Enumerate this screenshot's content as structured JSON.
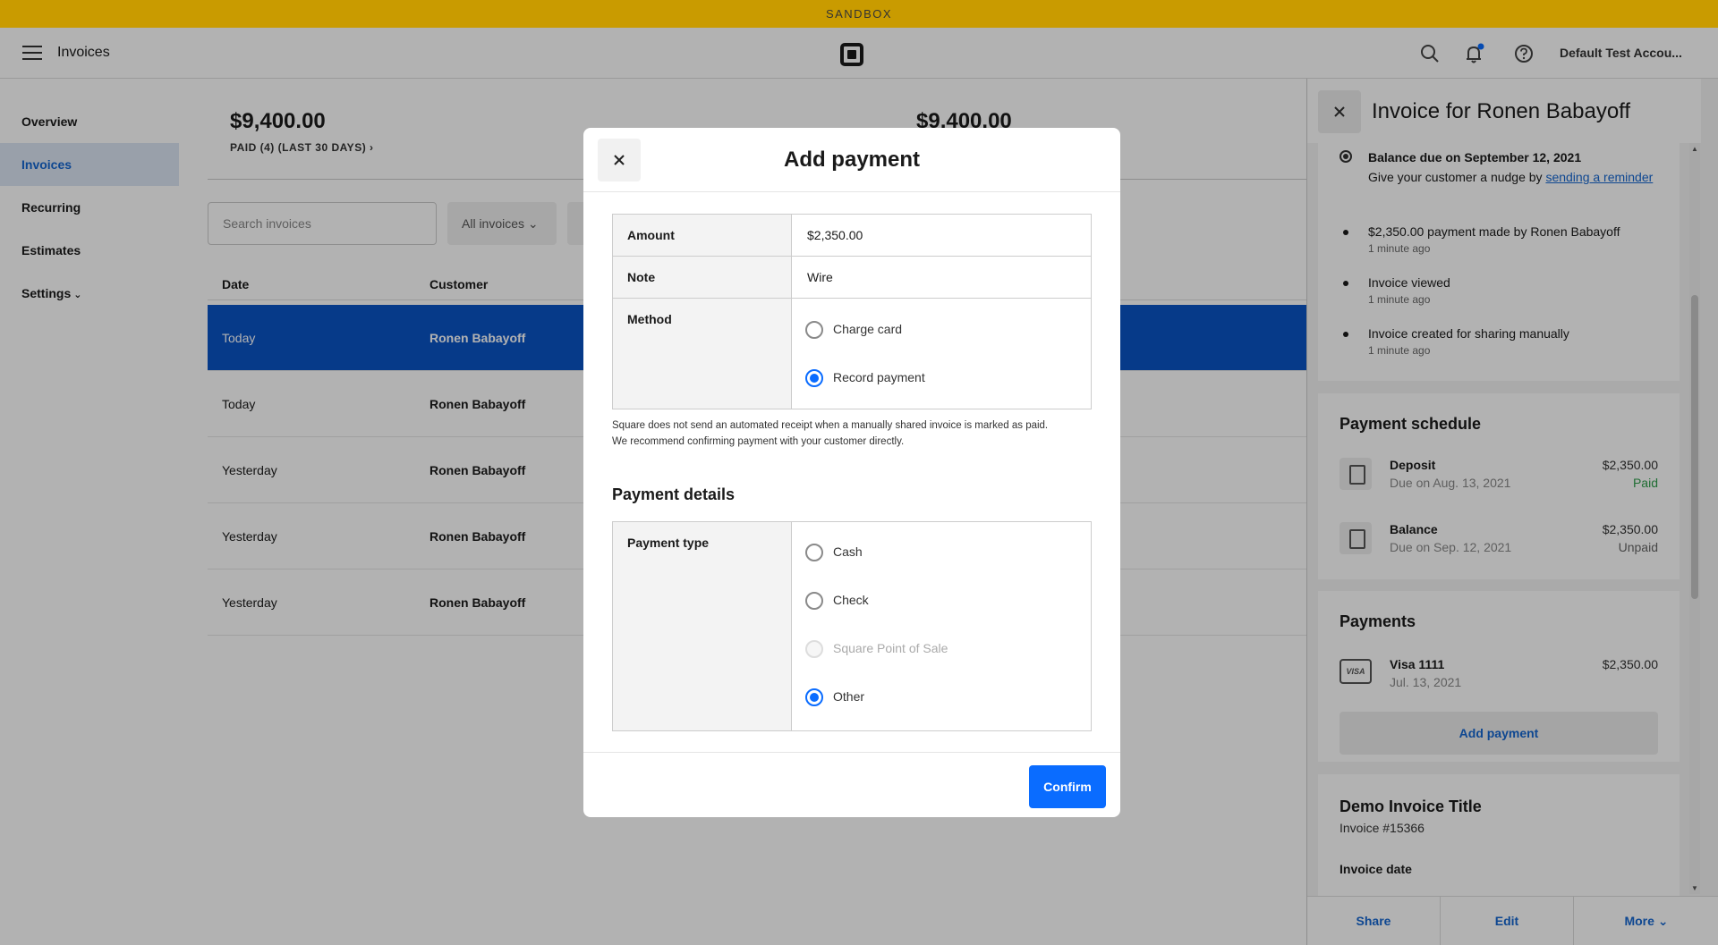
{
  "banner": {
    "text": "SANDBOX"
  },
  "topnav": {
    "title": "Invoices",
    "account": "Default Test Accou..."
  },
  "sidebar": {
    "items": [
      {
        "label": "Overview"
      },
      {
        "label": "Invoices"
      },
      {
        "label": "Recurring"
      },
      {
        "label": "Estimates"
      },
      {
        "label": "Settings"
      }
    ]
  },
  "main": {
    "stats": [
      {
        "value": "$9,400.00",
        "label": "PAID (4) (LAST 30 DAYS)"
      },
      {
        "value": "$9,400.00",
        "label": ""
      }
    ],
    "search_placeholder": "Search invoices",
    "filter_label": "All invoices",
    "columns": {
      "date": "Date",
      "customer": "Customer"
    },
    "rows": [
      {
        "date": "Today",
        "customer": "Ronen Babayoff"
      },
      {
        "date": "Today",
        "customer": "Ronen Babayoff"
      },
      {
        "date": "Yesterday",
        "customer": "Ronen Babayoff"
      },
      {
        "date": "Yesterday",
        "customer": "Ronen Babayoff"
      },
      {
        "date": "Yesterday",
        "customer": "Ronen Babayoff"
      }
    ]
  },
  "panel": {
    "title": "Invoice for Ronen Babayoff",
    "timeline": {
      "balance_due": "Balance due on September 12, 2021",
      "nudge_text": "Give your customer a nudge by ",
      "nudge_link": "sending a reminder",
      "events": [
        {
          "text": "$2,350.00 payment made by Ronen Babayoff",
          "time": "1 minute ago"
        },
        {
          "text": "Invoice viewed",
          "time": "1 minute ago"
        },
        {
          "text": "Invoice created for sharing manually",
          "time": "1 minute ago"
        }
      ]
    },
    "schedule": {
      "title": "Payment schedule",
      "items": [
        {
          "name": "Deposit",
          "due": "Due on Aug. 13, 2021",
          "amount": "$2,350.00",
          "status": "Paid"
        },
        {
          "name": "Balance",
          "due": "Due on Sep. 12, 2021",
          "amount": "$2,350.00",
          "status": "Unpaid"
        }
      ]
    },
    "payments": {
      "title": "Payments",
      "card_brand": "VISA",
      "card": "Visa 1111",
      "date": "Jul. 13, 2021",
      "amount": "$2,350.00",
      "add_label": "Add payment"
    },
    "details": {
      "title": "Demo Invoice Title",
      "number": "Invoice #15366",
      "date_label": "Invoice date"
    },
    "footer": {
      "share": "Share",
      "edit": "Edit",
      "more": "More"
    }
  },
  "modal": {
    "title": "Add payment",
    "amount_label": "Amount",
    "amount_value": "$2,350.00",
    "note_label": "Note",
    "note_value": "Wire",
    "method_label": "Method",
    "methods": [
      {
        "label": "Charge card",
        "selected": false
      },
      {
        "label": "Record payment",
        "selected": true
      }
    ],
    "notice_line1": "Square does not send an automated receipt when a manually shared invoice is marked as paid.",
    "notice_line2": "We recommend confirming payment with your customer directly.",
    "details_title": "Payment details",
    "type_label": "Payment type",
    "types": [
      {
        "label": "Cash",
        "state": "off"
      },
      {
        "label": "Check",
        "state": "off"
      },
      {
        "label": "Square Point of Sale",
        "state": "disabled"
      },
      {
        "label": "Other",
        "state": "on"
      }
    ],
    "confirm_label": "Confirm"
  },
  "colors": {
    "accent": "#0a6cff",
    "banner": "#c99b00",
    "selected_row": "#0a53c4",
    "paid": "#2e9e4b"
  }
}
